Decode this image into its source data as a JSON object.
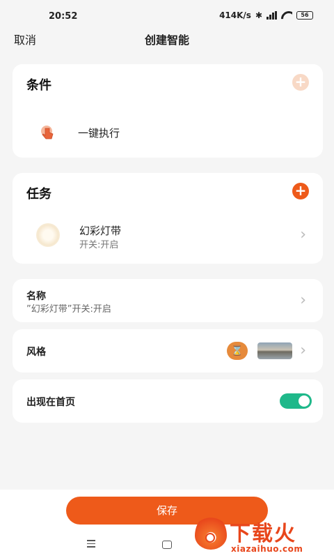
{
  "status_bar": {
    "time": "20:52",
    "network_speed": "414K/s",
    "battery": "56"
  },
  "nav": {
    "cancel_label": "取消",
    "title": "创建智能"
  },
  "condition": {
    "title": "条件",
    "item_label": "一键执行"
  },
  "task": {
    "title": "任务",
    "item_name": "幻彩灯带",
    "item_status": "开关:开启"
  },
  "name_row": {
    "label": "名称",
    "value": "”幻彩灯带”开关:开启"
  },
  "style_row": {
    "label": "风格"
  },
  "home_row": {
    "label": "出现在首页",
    "enabled": true
  },
  "save_button": {
    "label": "保存"
  },
  "watermark": {
    "text": "下载火",
    "url": "xiazaihuo.com"
  },
  "colors": {
    "accent": "#ee5a1a",
    "toggle_on": "#1fb88a",
    "background": "#f5f5f5"
  }
}
